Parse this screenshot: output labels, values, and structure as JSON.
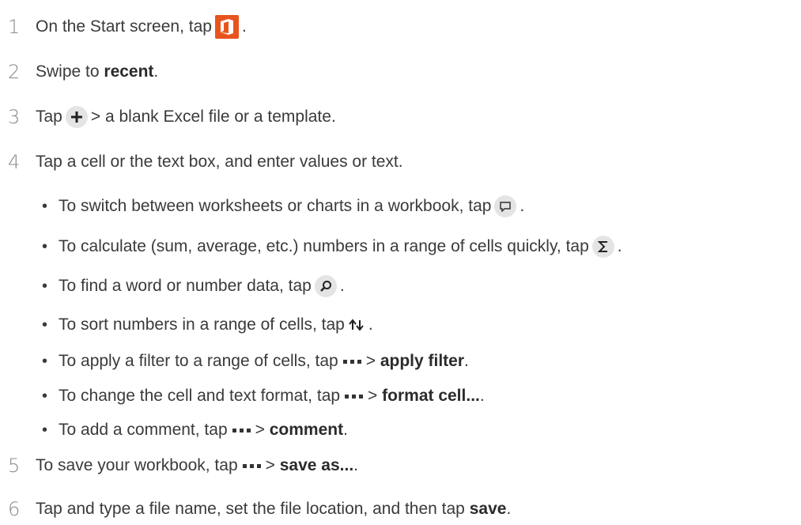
{
  "steps": [
    {
      "num": "1",
      "pre": "On the Start screen, tap",
      "post": "."
    },
    {
      "num": "2",
      "pre": "Swipe to",
      "bold": "recent",
      "post": "."
    },
    {
      "num": "3",
      "pre": "Tap",
      "post": "> a blank Excel file or a template."
    },
    {
      "num": "4",
      "pre": "Tap a cell or the text box, and enter values or text."
    },
    {
      "num": "5",
      "pre": "To save your workbook, tap",
      "mid": ">",
      "bold": "save as...",
      "post": "."
    },
    {
      "num": "6",
      "pre": "Tap and type a file name, set the file location, and then tap",
      "bold": "save",
      "post": "."
    }
  ],
  "bullets": [
    {
      "pre": "To switch between worksheets or charts in a workbook, tap",
      "post": "."
    },
    {
      "pre": "To calculate (sum, average, etc.) numbers in a range of cells quickly, tap",
      "post": "."
    },
    {
      "pre": "To find a word or number data, tap",
      "post": "."
    },
    {
      "pre": "To sort numbers in a range of cells, tap",
      "post": "."
    },
    {
      "pre": "To apply a filter to a range of cells, tap",
      "mid": ">",
      "bold": "apply filter",
      "post": "."
    },
    {
      "pre": "To change the cell and text format, tap",
      "mid": ">",
      "bold": "format cell...",
      "post": "."
    },
    {
      "pre": "To add a comment, tap",
      "mid": ">",
      "bold": "comment",
      "post": "."
    }
  ],
  "bullet_char": "•",
  "icons": {
    "office": "office-app-icon",
    "plus": "plus-icon",
    "sheets": "sheets-switch-icon",
    "sigma": "sigma-icon",
    "search": "search-icon",
    "sort": "sort-icon",
    "more": "more-dots-icon"
  },
  "colors": {
    "office": "#e8541e",
    "icon_bg": "#e4e4e4"
  }
}
